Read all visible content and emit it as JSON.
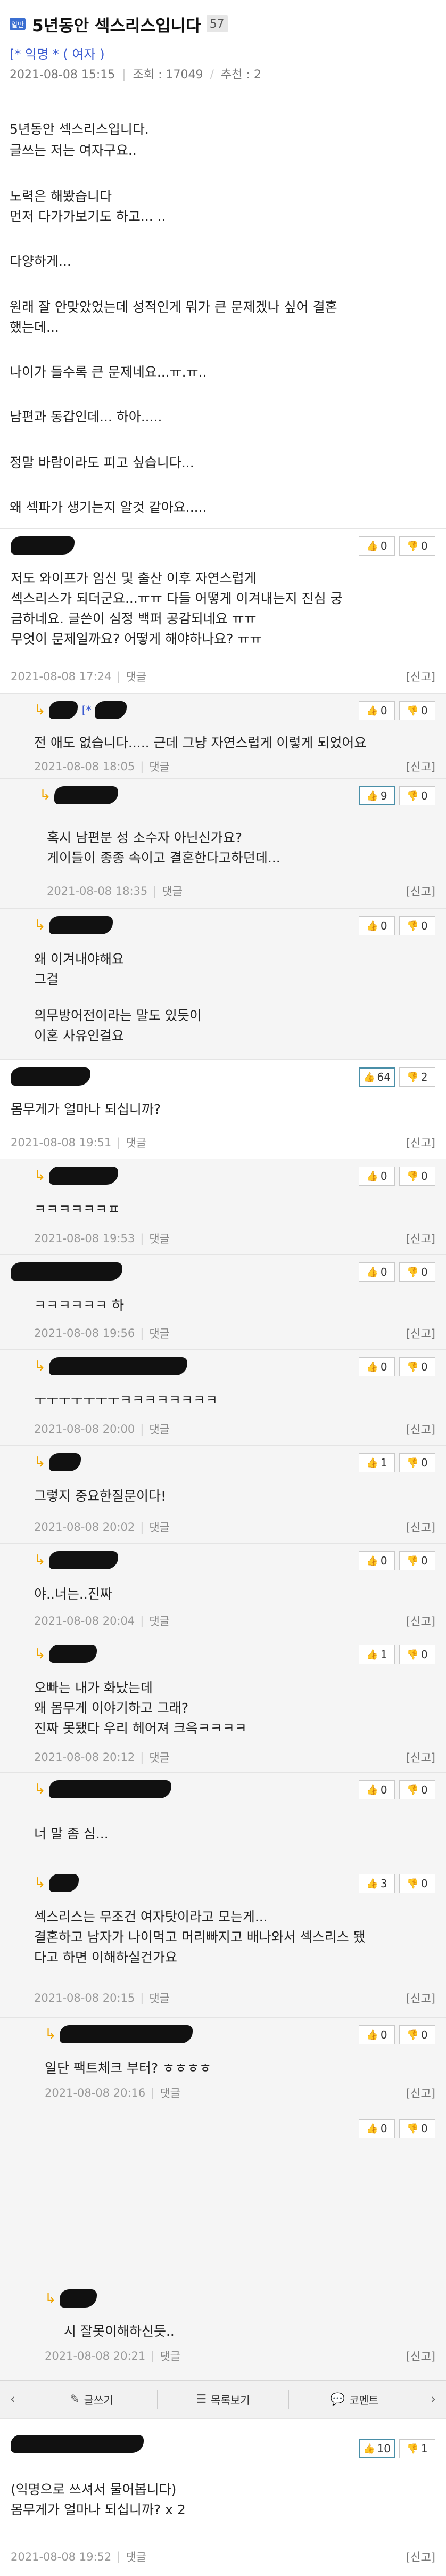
{
  "post": {
    "category_badge": "일반",
    "title": "5년동안 섹스리스입니다",
    "reply_count": "57",
    "author": "[* 익명 * ( 여자 )",
    "date": "2021-08-08 15:15",
    "views_label": "조회 : 17049",
    "recommend_label": "추천 : 2",
    "body_lines": [
      "5년동안 섹스리스입니다.",
      "글쓰는 저는 여자구요..",
      "노력은 해봤습니다",
      "먼저 다가가보기도 하고... ..",
      "다양하게...",
      "원래 잘 안맞았었는데 성적인게 뭐가 큰 문제겠나 싶어 결혼",
      "했는데...",
      "나이가 들수록 큰 문제네요...ㅠ.ㅠ..",
      "남편과 동갑인데... 하아.....",
      "정말 바람이라도 피고 싶습니다...",
      "왜 섹파가 생기는지 알것 같아요....."
    ]
  },
  "ui": {
    "reply_link": "댓글",
    "report": "[신고]",
    "thumb_up_icon": "thumbs-up-icon",
    "thumb_down_icon": "thumbs-down-icon"
  },
  "comments": [
    {
      "lines": [
        "저도 와이프가 임신 및 출산 이후 자연스럽게",
        "섹스리스가 되더군요...ㅠㅠ 다들 어떻게 이겨내는지 진심 궁",
        "금하네요. 글쓴이 심정 백퍼 공감되네요 ㅠㅠ",
        "무엇이 문제일까요? 어떻게 해야하나요? ㅠㅠ"
      ],
      "date": "2021-08-08 17:24",
      "up": "0",
      "down": "0"
    },
    {
      "nick_extra": "[*",
      "lines": [
        "전 애도 없습니다..... 근데 그냥 자연스럽게 이렇게 되었어요"
      ],
      "date": "2021-08-08 18:05",
      "up": "0",
      "down": "0"
    },
    {
      "lines": [
        "혹시 남편분 성 소수자 아닌신가요?",
        "게이들이 종종 속이고 결혼한다고하던데..."
      ],
      "date": "2021-08-08 18:35",
      "up": "9",
      "down": "0"
    },
    {
      "lines": [
        "왜 이겨내야해요",
        "그걸",
        "의무방어전이라는 말도 있듯이",
        "이혼 사유인걸요"
      ],
      "date": "",
      "up": "0",
      "down": "0"
    },
    {
      "lines": [
        "몸무게가 얼마나 되십니까?"
      ],
      "date": "2021-08-08 19:51",
      "up": "64",
      "down": "2"
    },
    {
      "lines": [
        "ㅋㅋㅋㅋㅋㅋㅍ"
      ],
      "date": "2021-08-08 19:53",
      "up": "0",
      "down": "0"
    },
    {
      "lines": [
        "ㅋㅋㅋㅋㅋㅋ 하"
      ],
      "date": "2021-08-08 19:56",
      "up": "0",
      "down": "0"
    },
    {
      "lines": [
        "ㅜㅜㅜㅜㅜㅜㅜㅋㅋㅋㅋㅋㅋㅋㅋ"
      ],
      "date": "2021-08-08 20:00",
      "up": "0",
      "down": "0"
    },
    {
      "lines": [
        "그렇지 중요한질문이다!"
      ],
      "date": "2021-08-08 20:02",
      "up": "1",
      "down": "0"
    },
    {
      "lines": [
        "야..너는..진짜"
      ],
      "date": "2021-08-08 20:04",
      "up": "0",
      "down": "0"
    },
    {
      "lines": [
        "오빠는 내가 화났는데",
        "왜 몸무게 이야기하고 그래?",
        "진짜 못됐다 우리 헤어져 크윽ㅋㅋㅋㅋ"
      ],
      "date": "2021-08-08 20:12",
      "up": "1",
      "down": "0"
    },
    {
      "lines": [
        "너 말 좀 심..."
      ],
      "date": "",
      "up": "0",
      "down": "0"
    },
    {
      "lines": [
        "섹스리스는 무조건 여자탓이라고 모는게...",
        "결혼하고 남자가 나이먹고 머리빠지고 배나와서 섹스리스 됐",
        "다고 하면 이해하실건가요"
      ],
      "date": "2021-08-08 20:15",
      "up": "3",
      "down": "0"
    },
    {
      "lines": [
        "일단 팩트체크 부터? ㅎㅎㅎㅎ"
      ],
      "date": "2021-08-08 20:16",
      "up": "0",
      "down": "0"
    },
    {
      "lines": [
        "시 잘못이해하신듯.."
      ],
      "date": "2021-08-08 20:21",
      "up": "0",
      "down": "0"
    },
    {
      "lines": [
        "(익명으로 쓰셔서 물어봅니다)",
        "몸무게가 얼마나 되십니까? x 2"
      ],
      "date": "2021-08-08 19:52",
      "up": "10",
      "down": "1"
    }
  ],
  "toolbar": {
    "write": "글쓰기",
    "list": "목록보기",
    "comment": "코멘트",
    "prev_icon": "chevron-left-icon",
    "next_icon": "chevron-right-icon"
  }
}
